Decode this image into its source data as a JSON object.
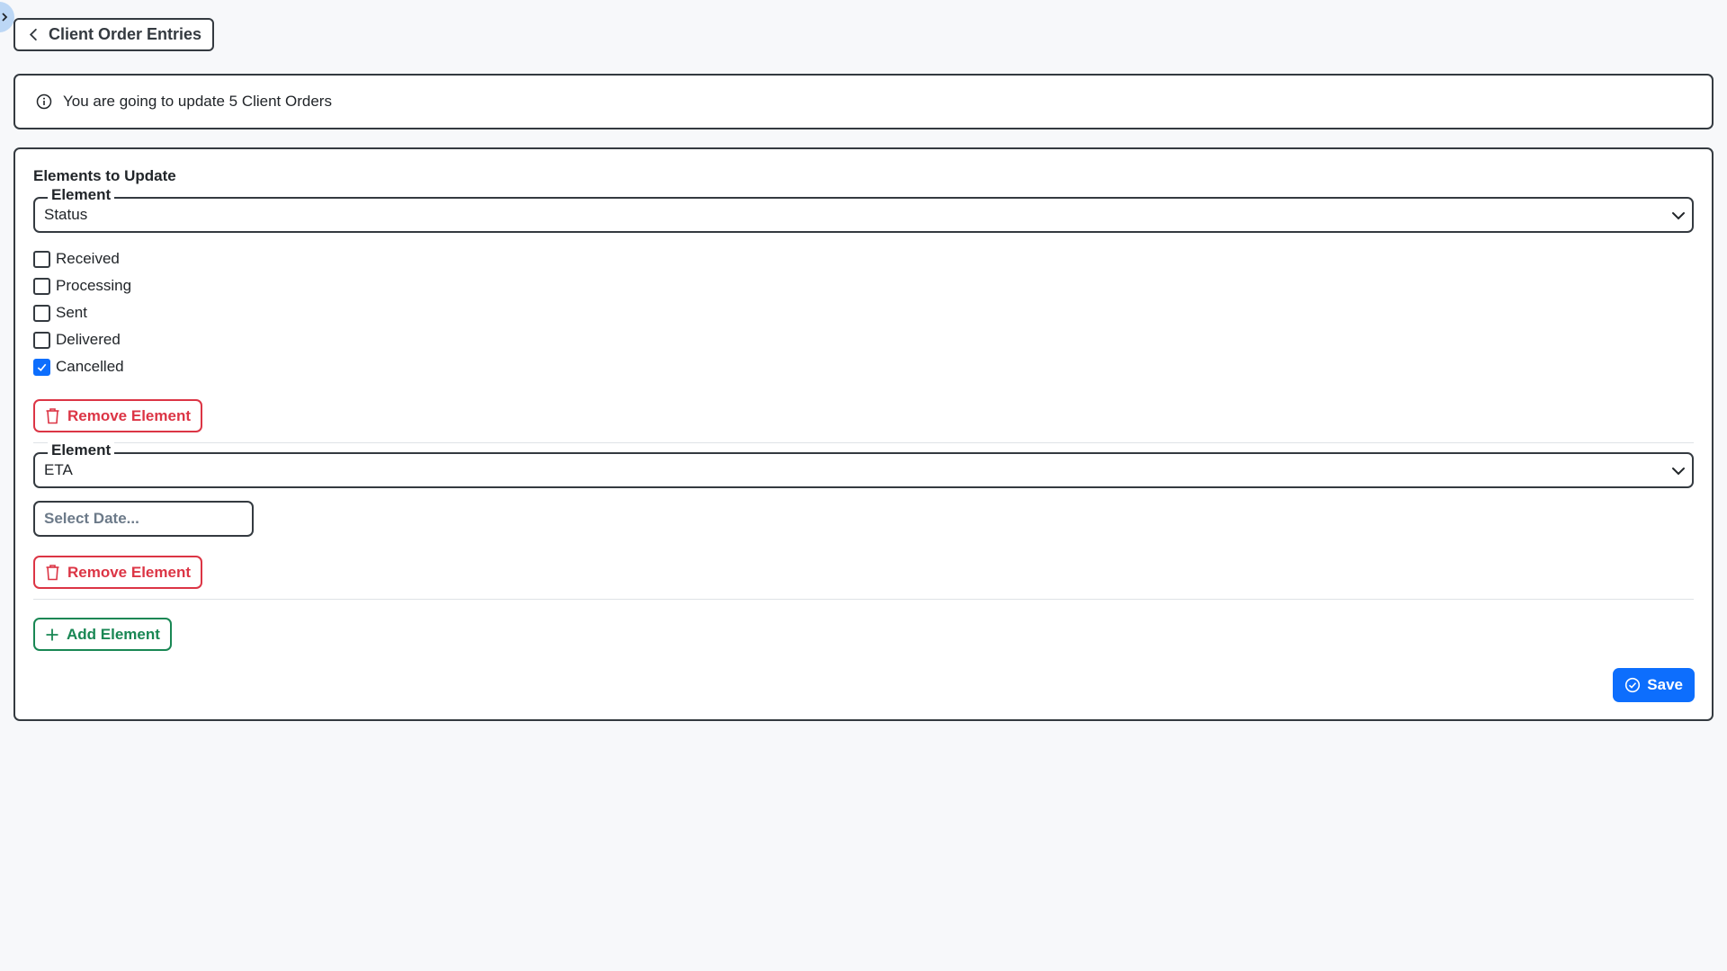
{
  "nav": {
    "back_label": "Client Order Entries",
    "back_icon": "chevron-left-icon",
    "sidebar_toggle_icon": "chevron-right-icon"
  },
  "info": {
    "icon": "info-circle-icon",
    "message": "You are going to update 5 Client Orders"
  },
  "form": {
    "section_title": "Elements to Update",
    "elements": [
      {
        "legend": "Element",
        "selected": "Status",
        "options": [
          {
            "label": "Received",
            "checked": false
          },
          {
            "label": "Processing",
            "checked": false
          },
          {
            "label": "Sent",
            "checked": false
          },
          {
            "label": "Delivered",
            "checked": false
          },
          {
            "label": "Cancelled",
            "checked": true
          }
        ],
        "remove_label": "Remove Element"
      },
      {
        "legend": "Element",
        "selected": "ETA",
        "date_placeholder": "Select Date...",
        "remove_label": "Remove Element"
      }
    ],
    "add_label": "Add Element",
    "save_label": "Save"
  },
  "colors": {
    "primary": "#0d6efd",
    "danger": "#dc3545",
    "success": "#198754",
    "border": "#343a40",
    "background": "#f7f8fa"
  }
}
